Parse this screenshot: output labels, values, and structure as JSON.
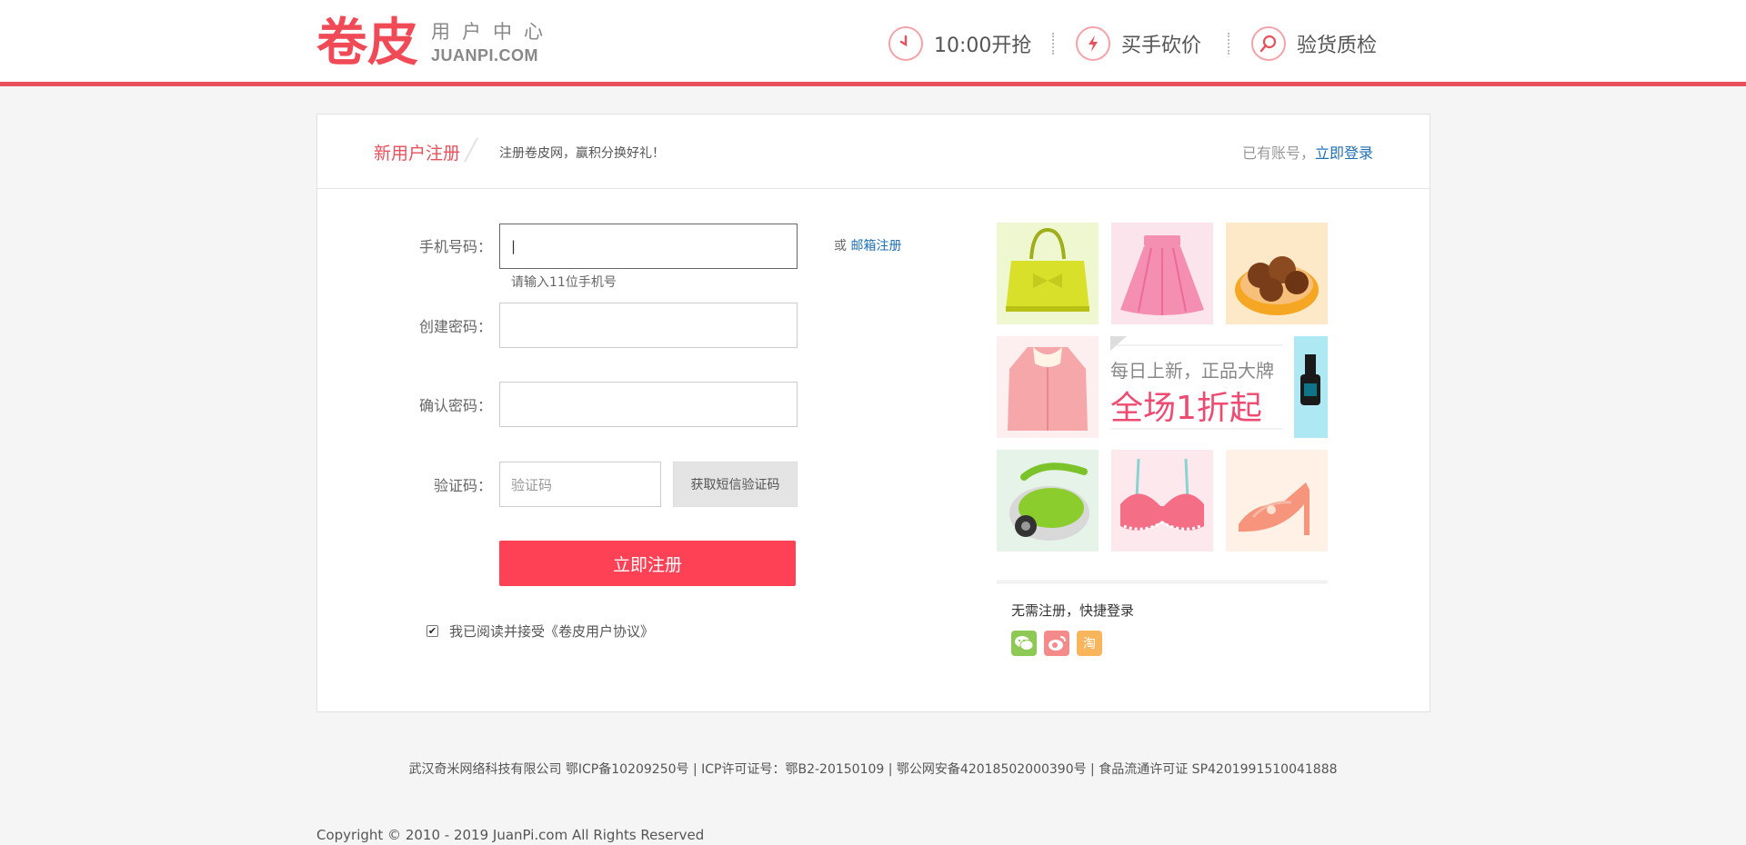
{
  "header": {
    "logo_text": "卷皮",
    "logo_sub": "用户中心",
    "logo_domain": "JUANPI.COM",
    "features": [
      {
        "icon": "clock-icon",
        "label": "10:00开抢"
      },
      {
        "icon": "lightning-icon",
        "label": "买手砍价"
      },
      {
        "icon": "magnifier-icon",
        "label": "验货质检"
      }
    ]
  },
  "register": {
    "title": "新用户注册",
    "subtitle": "注册卷皮网，赢积分换好礼！",
    "have_account": "已有账号，",
    "login_link": "立即登录",
    "phone_label": "手机号码：",
    "phone_value": "|",
    "phone_hint": "请输入11位手机号",
    "or_text": "或",
    "email_register": "邮箱注册",
    "password_label": "创建密码：",
    "confirm_label": "确认密码：",
    "captcha_label": "验证码：",
    "captcha_placeholder": "验证码",
    "sms_button": "获取短信验证码",
    "submit": "立即注册",
    "agree_text": "我已阅读并接受《卷皮用户协议》"
  },
  "promo": {
    "banner_line1": "每日上新，正品大牌",
    "banner_line2": "全场1折起",
    "quick_login": "无需注册，快捷登录",
    "social_icons": [
      "wechat-icon",
      "weibo-icon",
      "taobao-icon"
    ],
    "taobao_glyph": "淘"
  },
  "footer": {
    "icp": "武汉奇米网络科技有限公司 鄂ICP备10209250号 | ICP许可证号：鄂B2-20150109 | 鄂公网安备42018502000390号 | 食品流通许可证 SP4201991510041888",
    "copyright": "Copyright © 2010 - 2019 JuanPi.com All Rights Reserved"
  },
  "colors": {
    "brand_red": "#e8505b",
    "submit_red": "#ff4156",
    "link_blue": "#1f6fb5"
  }
}
